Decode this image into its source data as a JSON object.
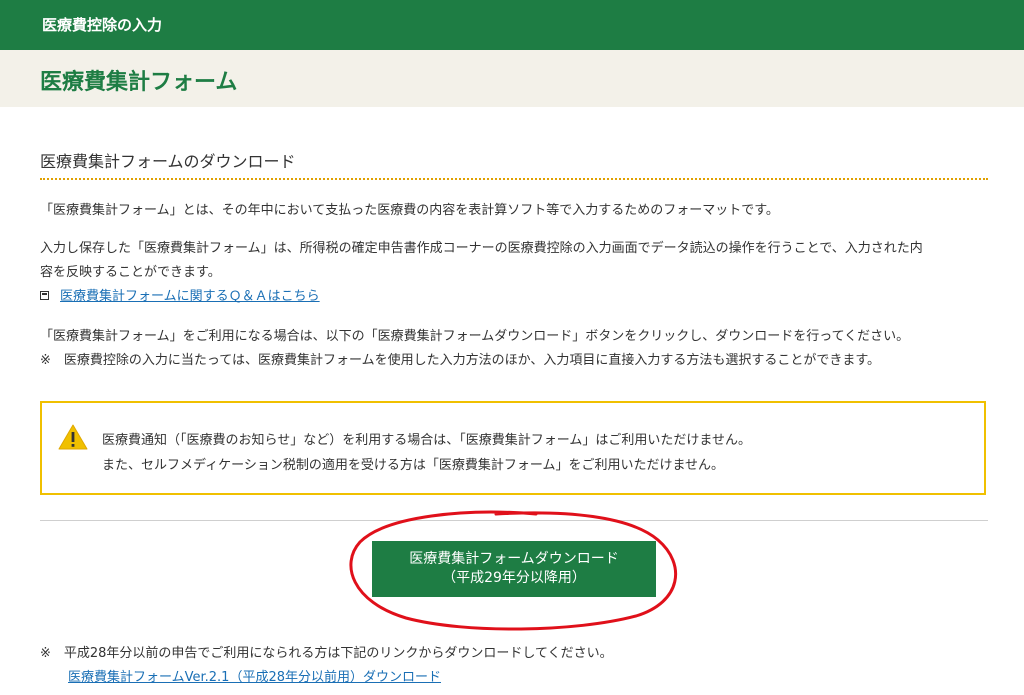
{
  "header": {
    "title": "医療費控除の入力"
  },
  "page": {
    "title": "医療費集計フォーム"
  },
  "section": {
    "heading": "医療費集計フォームのダウンロード"
  },
  "body": {
    "intro": "「医療費集計フォーム」とは、その年中において支払った医療費の内容を表計算ソフト等で入力するためのフォーマットです。",
    "save_line1": "入力し保存した「医療費集計フォーム」は、所得税の確定申告書作成コーナーの医療費控除の入力画面でデータ読込の操作を行うことで、入力された内",
    "save_line2": "容を反映することができます。",
    "qa_link": "医療費集計フォームに関するＱ＆Ａはこちら",
    "usage": "「医療費集計フォーム」をご利用になる場合は、以下の「医療費集計フォームダウンロード」ボタンをクリックし、ダウンロードを行ってください。",
    "note": "※　医療費控除の入力に当たっては、医療費集計フォームを使用した入力方法のほか、入力項目に直接入力する方法も選択することができます。"
  },
  "warning": {
    "line1": "医療費通知（「医療費のお知らせ」など）を利用する場合は、「医療費集計フォーム」はご利用いただけません。",
    "line2": "また、セルフメディケーション税制の適用を受ける方は「医療費集計フォーム」をご利用いただけません。"
  },
  "download_button": {
    "line1": "医療費集計フォームダウンロード",
    "line2": "（平成29年分以降用）"
  },
  "footer": {
    "note": "※　平成28年分以前の申告でご利用になられる方は下記のリンクからダウンロードしてください。",
    "legacy_link": "医療費集計フォームVer.2.1（平成28年分以前用）ダウンロード"
  },
  "colors": {
    "brand_green": "#1e7d44",
    "title_bg": "#f3f1e9",
    "warning_border": "#f0c000",
    "link": "#1a6fb5",
    "annotation_red": "#e0101a"
  }
}
